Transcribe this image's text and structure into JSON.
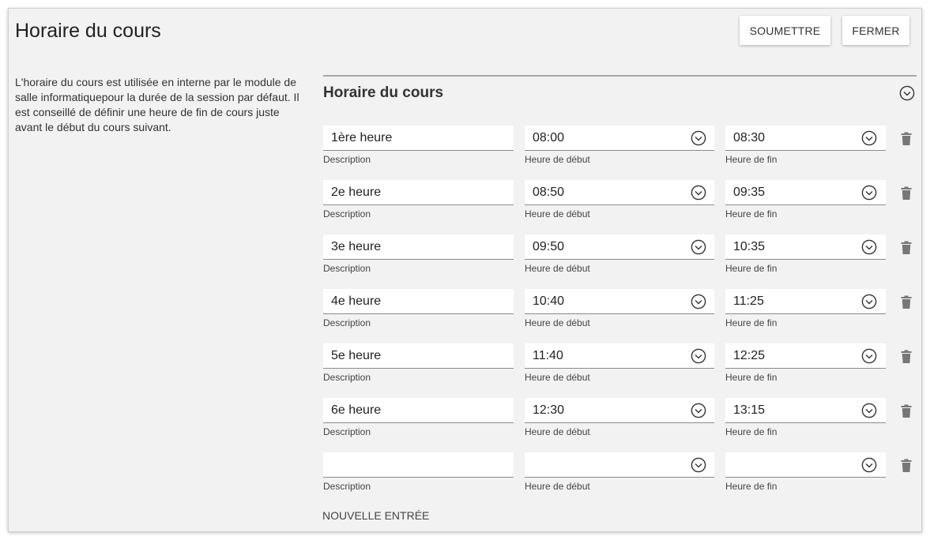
{
  "header": {
    "title": "Horaire du cours",
    "submit_label": "SOUMETTRE",
    "close_label": "FERMER"
  },
  "help": {
    "text": "L'horaire du cours est utilisée en interne par le module de salle informatiquepour la durée de la session par défaut. Il est conseillé de définir une heure de fin de cours juste avant le début du cours suivant."
  },
  "section": {
    "title": "Horaire du cours"
  },
  "labels": {
    "description": "Description",
    "start": "Heure de début",
    "end": "Heure de fin"
  },
  "rows": [
    {
      "description": "1ère heure",
      "start": "08:00",
      "end": "08:30"
    },
    {
      "description": "2e heure",
      "start": "08:50",
      "end": "09:35"
    },
    {
      "description": "3e heure",
      "start": "09:50",
      "end": "10:35"
    },
    {
      "description": "4e heure",
      "start": "10:40",
      "end": "11:25"
    },
    {
      "description": "5e heure",
      "start": "11:40",
      "end": "12:25"
    },
    {
      "description": "6e heure",
      "start": "12:30",
      "end": "13:15"
    },
    {
      "description": "",
      "start": "",
      "end": ""
    }
  ],
  "new_entry_label": "NOUVELLE ENTRÉE",
  "icons": {
    "chevron": "chevron-down-circle-icon",
    "delete": "trash-icon"
  },
  "colors": {
    "panel_bg": "#f2f2f2",
    "field_bg": "#ffffff",
    "icon": "#333333",
    "trash": "#777777"
  }
}
